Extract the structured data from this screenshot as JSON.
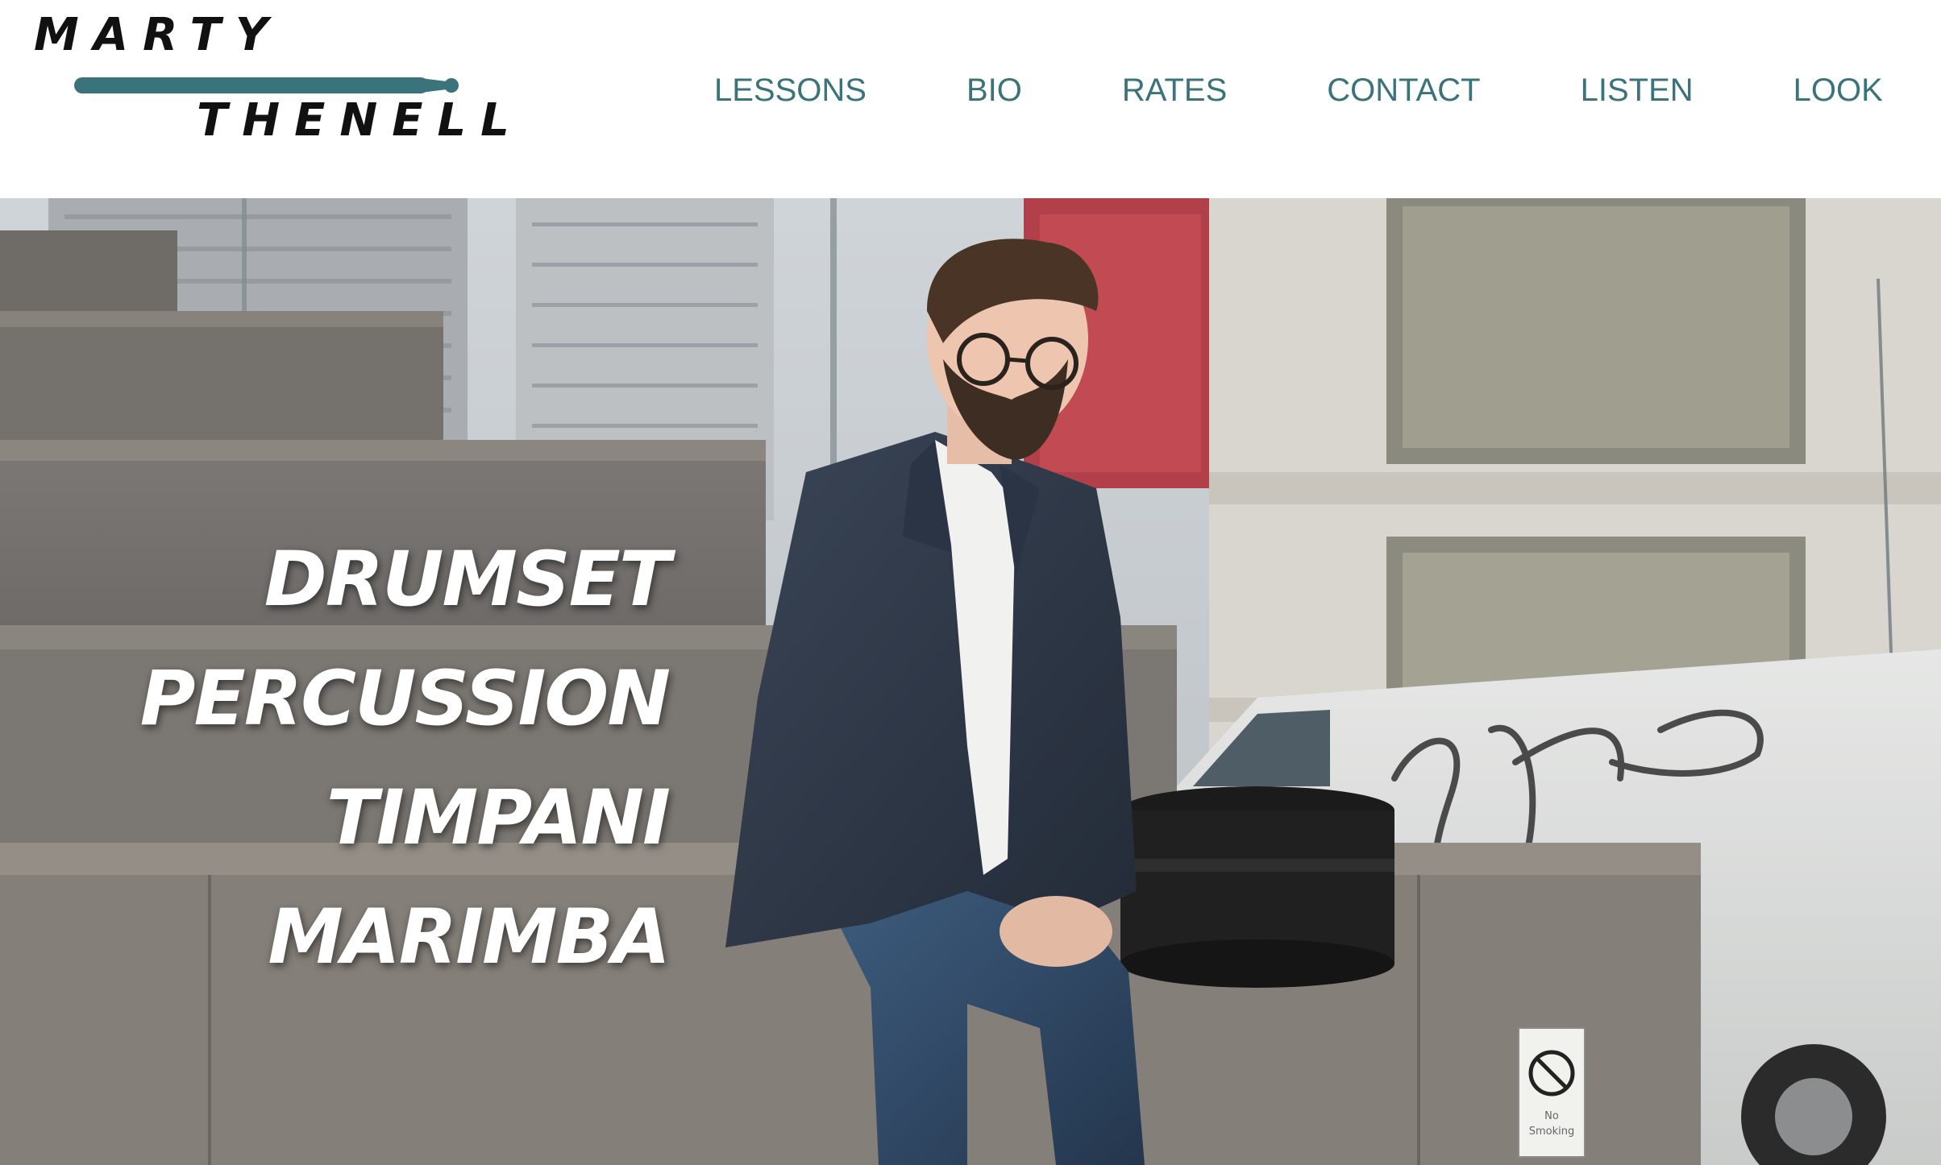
{
  "site": {
    "logo": {
      "line1": "MARTY",
      "line2": "THENELL",
      "icon": "drumstick-icon",
      "stick_color": "#3a737a"
    },
    "nav": [
      {
        "label": "LESSONS"
      },
      {
        "label": "BIO"
      },
      {
        "label": "RATES"
      },
      {
        "label": "CONTACT"
      },
      {
        "label": "LISTEN"
      },
      {
        "label": "LOOK"
      }
    ],
    "accent_color": "#3a737a"
  },
  "hero": {
    "words": [
      "DRUMSET",
      "PERCUSSION",
      "TIMPANI",
      "MARIMBA"
    ],
    "sign_text": [
      "No",
      "Smoking"
    ]
  }
}
